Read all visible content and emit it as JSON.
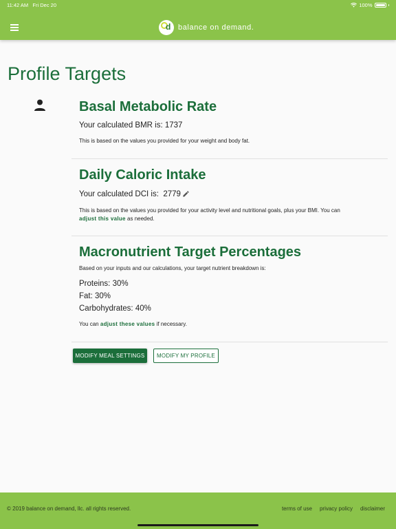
{
  "status_bar": {
    "time": "11:42 AM",
    "date": "Fri Dec 20",
    "battery": "100%"
  },
  "header": {
    "brand_name": "balance on demand.",
    "logo_letter": "d"
  },
  "page_title": "Profile Targets",
  "bmr": {
    "title": "Basal Metabolic Rate",
    "value_text": "Your calculated BMR is: 1737",
    "note": "This is based on the values you provided for your weight and body fat."
  },
  "dci": {
    "title": "Daily Caloric Intake",
    "label": "Your calculated DCI is:",
    "value": "2779",
    "note": "This is based on the values you provided for your activity level and nutritional goals, plus your BMI. You can",
    "link": "adjust this value",
    "note_end": "as needed."
  },
  "macros": {
    "title": "Macronutrient Target Percentages",
    "intro": "Based on your inputs and our calculations, your target nutrient breakdown is:",
    "proteins": "Proteins: 30%",
    "fat": "Fat: 30%",
    "carbs": "Carbohydrates: 40%",
    "adjust_prefix": "You can",
    "adjust_link": "adjust these values",
    "adjust_suffix": "if necessary."
  },
  "buttons": {
    "meal_settings": "Modify Meal Settings",
    "profile": "Modify My Profile"
  },
  "footer": {
    "copyright": "© 2019 balance on demand, llc. all rights reserved.",
    "links": [
      "terms of use",
      "privacy policy",
      "disclaimer"
    ]
  },
  "colors": {
    "brand_green": "#8bc34a",
    "heading_green": "#1b6e3a"
  }
}
